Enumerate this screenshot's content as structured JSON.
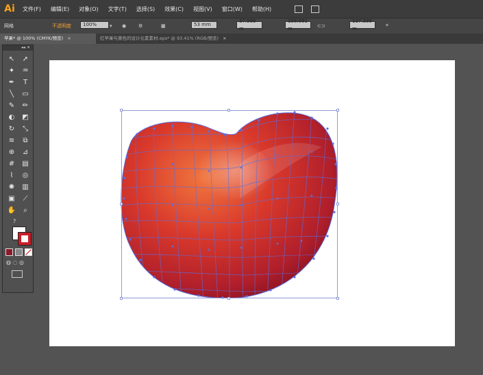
{
  "app": {
    "logo": "Ai"
  },
  "menu": [
    "文件(F)",
    "编辑(E)",
    "对象(O)",
    "文字(T)",
    "选择(S)",
    "效果(C)",
    "视图(V)",
    "窗口(W)",
    "帮助(H)"
  ],
  "control": {
    "label": "网格",
    "opacity_label": "不透明度",
    "opacity_value": "100%",
    "w_value": "53 mm",
    "x_value": "37.589 m",
    "y_value": "158.081 m",
    "h_value": "137.386 m"
  },
  "tabs": [
    {
      "label": "苹果* @ 100% (CMYK/预览)",
      "active": true
    },
    {
      "label": "红苹果与黄色的设计元素素材.eps* @ 93.41% (RGB/预览)",
      "active": false
    }
  ],
  "toolbox": {
    "header": "◂◂ ✕"
  },
  "colors": {
    "accent": "#f7a21b",
    "mesh": "#5b6fe0",
    "fill_swatch": "#8b1a2a",
    "stroke_swatch": "#c81e2a"
  },
  "icons": [
    "direct-selection",
    "selection",
    "magic-wand",
    "lasso",
    "pen",
    "type",
    "line",
    "rectangle",
    "paintbrush",
    "pencil",
    "blob-brush",
    "eraser",
    "rotate",
    "scale",
    "warp",
    "free-transform",
    "shape-builder",
    "perspective",
    "mesh",
    "gradient",
    "eyedropper",
    "blend",
    "symbol-sprayer",
    "column-graph",
    "artboard",
    "slice",
    "hand",
    "zoom"
  ]
}
